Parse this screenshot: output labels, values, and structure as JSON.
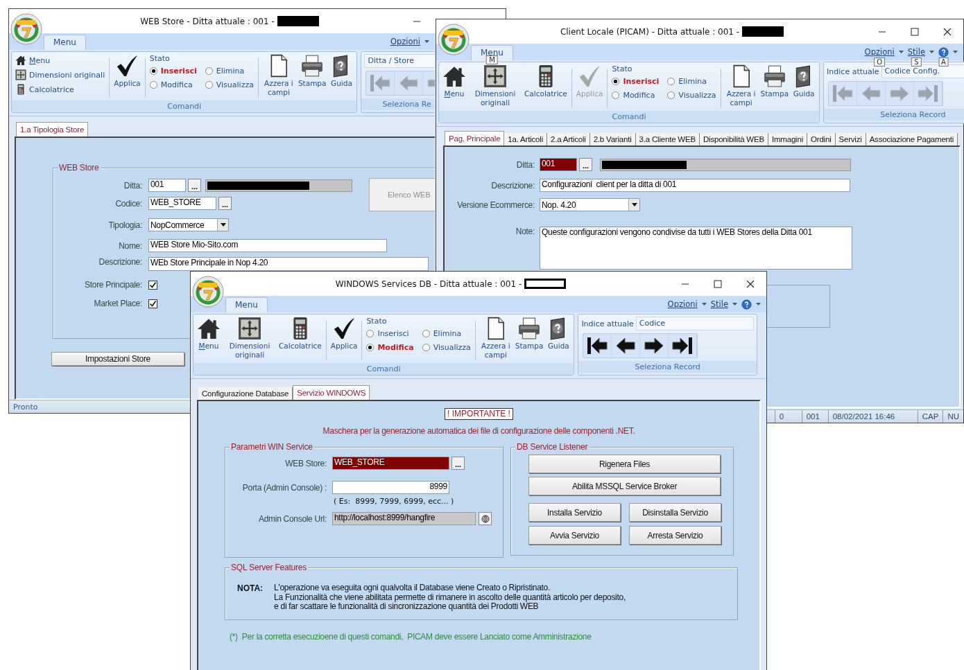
{
  "web_store_window": {
    "title": "WEB Store - Ditta attuale : 001 -",
    "ribbon": {
      "menu_tab": "Menu",
      "links": [
        {
          "label": "Opzioni"
        }
      ],
      "tools": [
        {
          "label": "Menu"
        },
        {
          "label": "Dimensioni originali"
        },
        {
          "label": "Calcolatrice"
        }
      ],
      "apply": {
        "label": "Applica",
        "disabled": false
      },
      "state_title": "Stato",
      "modes": [
        {
          "label": "Inserisci",
          "selected": true
        },
        {
          "label": "Elimina",
          "selected": false
        },
        {
          "label": "Modifica",
          "selected": false
        },
        {
          "label": "Visualizza",
          "selected": false
        }
      ],
      "docs": [
        {
          "label": "Azzera i campi"
        },
        {
          "label": "Stampa"
        },
        {
          "label": "Guida"
        }
      ],
      "group_label": "Comandi",
      "nav": {
        "index_value": "Ditta / Store",
        "arrows_disabled": true,
        "group_label": "Seleziona Re"
      }
    },
    "tabs": [
      {
        "label": "1.a Tipologia Store",
        "selected": true
      }
    ],
    "group_title": "WEB Store",
    "fields": [
      {
        "label": "Ditta:",
        "value": "001",
        "button": "...",
        "focused": false
      },
      {
        "label": "Codice:",
        "value": "WEB_STORE",
        "button": "...",
        "focused": false
      },
      {
        "label": "Tipologia:",
        "value": "NopCommerce",
        "focused": false
      },
      {
        "label": "Nome:",
        "value": "WEB Store Mio-Sito.com",
        "focused": false
      },
      {
        "label": "Descrizione:",
        "value": "WEb Store Principale in Nop 4.20",
        "focused": false
      }
    ],
    "checkboxes": [
      {
        "label": "Store Principale:",
        "checked": true
      },
      {
        "label": "Market Place:",
        "checked": true
      }
    ],
    "list_button": {
      "label": "Elenco WEB",
      "disabled": true
    },
    "settings_button": "Impostazioni Store",
    "status": "Pronto"
  },
  "client_window": {
    "title": "Client Locale (PICAM) - Ditta attuale : 001 -",
    "ribbon": {
      "menu_tab": "Menu",
      "menu_keytip": "M",
      "links": [
        {
          "label": "Opzioni",
          "keytip": "O"
        },
        {
          "label": "Stile",
          "keytip": "S"
        }
      ],
      "help_keytip": "A",
      "tools": [
        {
          "label": "Menu"
        },
        {
          "label": "Dimensioni originali"
        },
        {
          "label": "Calcolatrice"
        }
      ],
      "apply": {
        "label": "Applica",
        "disabled": true
      },
      "state_title": "Stato",
      "modes": [
        {
          "label": "Inserisci",
          "selected": true
        },
        {
          "label": "Elimina",
          "selected": false
        },
        {
          "label": "Modifica",
          "selected": false
        },
        {
          "label": "Visualizza",
          "selected": false
        }
      ],
      "docs": [
        {
          "label": "Azzera i campi"
        },
        {
          "label": "Stampa"
        },
        {
          "label": "Guida"
        }
      ],
      "group_label": "Comandi",
      "nav": {
        "index_label": "Indice attuale",
        "index_value": "Codice Config.",
        "arrows_disabled": true,
        "group_label": "Seleziona Record"
      }
    },
    "tabs": [
      {
        "label": "Pag. Principale",
        "selected": true
      },
      {
        "label": "1a. Articoli",
        "selected": false
      },
      {
        "label": "2.a Articoli",
        "selected": false
      },
      {
        "label": "2.b Varianti",
        "selected": false
      },
      {
        "label": "3.a Cliente WEB",
        "selected": false
      },
      {
        "label": "Disponibilità WEB",
        "selected": false
      },
      {
        "label": "Immagini",
        "selected": false
      },
      {
        "label": "Ordini",
        "selected": false
      },
      {
        "label": "Servizi",
        "selected": false
      },
      {
        "label": "Associazione Pagamenti",
        "selected": false
      }
    ],
    "fields": [
      {
        "label": "Ditta:",
        "value": "001",
        "button": "...",
        "focused": true
      },
      {
        "label": "Descrizione:",
        "value": "Configurazioni  client per la ditta di 001",
        "focused": false
      },
      {
        "label": "Versione Ecommerce:",
        "value": "Nop. 4.20",
        "focused": false
      },
      {
        "label": "Note:",
        "value": "Queste configurazioni vengono condivise da tutti i WEB Stores della Ditta 001",
        "focused": false
      }
    ],
    "status_cells": [
      "0",
      "001",
      "08/02/2021 16:46",
      "CAP",
      "NU"
    ]
  },
  "services_window": {
    "title": "WINDOWS Services DB - Ditta attuale : 001 -",
    "ribbon": {
      "menu_tab": "Menu",
      "links": [
        {
          "label": "Opzioni"
        },
        {
          "label": "Stile"
        }
      ],
      "tools": [
        {
          "label": "Menu"
        },
        {
          "label": "Dimensioni originali"
        },
        {
          "label": "Calcolatrice"
        }
      ],
      "apply": {
        "label": "Applica",
        "disabled": false
      },
      "state_title": "Stato",
      "modes": [
        {
          "label": "Inserisci",
          "selected": false
        },
        {
          "label": "Elimina",
          "selected": false
        },
        {
          "label": "Modifica",
          "selected": true
        },
        {
          "label": "Visualizza",
          "selected": false
        }
      ],
      "docs": [
        {
          "label": "Azzera i campi"
        },
        {
          "label": "Stampa"
        },
        {
          "label": "Guida"
        }
      ],
      "group_label": "Comandi",
      "nav": {
        "index_label": "Indice attuale",
        "index_value": "Codice",
        "arrows_disabled": false,
        "group_label": "Seleziona Record"
      }
    },
    "tabs": [
      {
        "label": "Configurazione Database",
        "selected": false
      },
      {
        "label": "Servizio WINDOWS",
        "selected": true
      }
    ],
    "notice": "! IMPORTANTE !",
    "description": "Maschera per la generazione automatica dei file di configurazione delle componenti .NET.",
    "params": {
      "title": "Parametri WIN Service",
      "fields": [
        {
          "label": "WEB Store:",
          "value": "WEB_STORE",
          "button": "...",
          "focused": true
        },
        {
          "label": "Porta (Admin Console) :",
          "value": "8999",
          "focused": false
        },
        {
          "label": "Admin Console Url:",
          "value": "http://localhost:8999/hangfire",
          "focused": false
        }
      ],
      "port_hint": "( Es:  8999, 7999, 6999, ecc... )"
    },
    "listener": {
      "title": "DB Service Listener",
      "buttons": [
        "Rigenera Files",
        "Abilita MSSQL Service Broker",
        "Installa Servizio",
        "Disinstalla Servizio",
        "Avvia Servizio",
        "Arresta Servizio"
      ]
    },
    "sql": {
      "title": "SQL Server Features",
      "note_label": "NOTA:",
      "note_lines": [
        "L'operazione va eseguita ogni qualvolta il Database viene Creato o Ripristinato.",
        "La Funzionalità che viene abilitata permette di rimanere in ascolto delle quantità articolo per deposito,",
        "e di far scattare le funzionalità di sincronizzazione quantità dei Prodotti WEB"
      ]
    },
    "footnote": "(*)  Per la corretta esecuzioene di questi comandi,  PICAM deve essere Lanciato come Amministrazione"
  }
}
